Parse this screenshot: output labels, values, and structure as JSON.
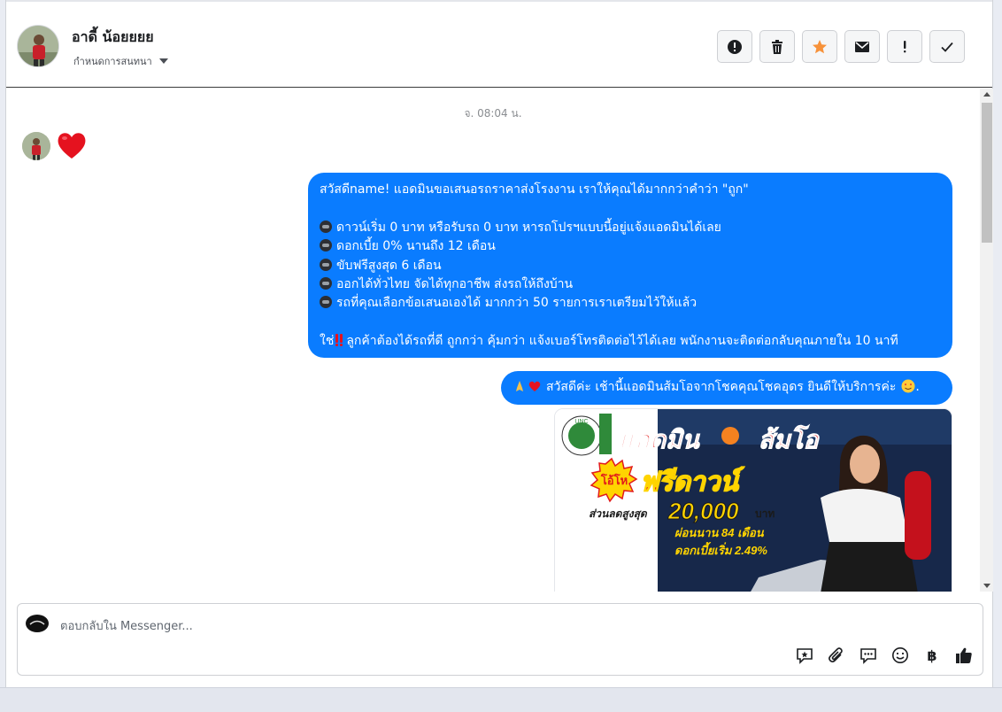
{
  "header": {
    "contact_name": "อาดี้ น้อยยยย",
    "label_action": "กำหนดการสนทนา",
    "actions": [
      {
        "name": "spam-button",
        "icon": "exclamation-circle-icon"
      },
      {
        "name": "delete-button",
        "icon": "trash-icon"
      },
      {
        "name": "star-button",
        "icon": "star-icon"
      },
      {
        "name": "mark-unread-button",
        "icon": "envelope-icon"
      },
      {
        "name": "follow-up-button",
        "icon": "exclamation-icon"
      },
      {
        "name": "mark-done-button",
        "icon": "check-icon"
      }
    ]
  },
  "thread": {
    "timestamp": "จ. 08:04 น.",
    "incoming_reaction": "heart-icon",
    "message1": {
      "line1": "สวัสดีname! แอดมินขอเสนอรถราคาส่งโรงงาน เราให้คุณได้มากกว่าคำว่า \"ถูก\"",
      "bullets": [
        "ดาวน์เริ่ม 0 บาท หรือรับรถ 0 บาท หารถโปรฯแบบนี้อยู่แจ้งแอดมินได้เลย",
        "ดอกเบี้ย 0% นานถึง 12 เดือน",
        "ขับฟรีสูงสุด 6 เดือน",
        "ออกได้ทั่วไทย จัดได้ทุกอาชีพ ส่งรถให้ถึงบ้าน",
        "รถที่คุณเลือกข้อเสนอเองได้ มากกว่า 50 รายการเราเตรียมไว้ให้แล้ว"
      ],
      "closing_prefix": "ใช่",
      "closing": "ลูกค้าต้องได้รถที่ดี ถูกกว่า คุ้มกว่า แจ้งเบอร์โทรติดต่อไว้ได้เลย พนักงานจะติดต่อกลับคุณภายใน 10 นาที"
    },
    "message2": {
      "text": "สวัสดีค่ะ เช้านี้แอดมินส้มโอจากโชคคุณโชคอุดร ยินดีให้บริการค่ะ",
      "trailing": "."
    },
    "promo_image": {
      "headline": "แอดมิน",
      "headline2": "ส้มโอ",
      "burst_label": "โอ้โห",
      "free_down": "ฟรีดาวน์",
      "discount_label": "ส่วนลดสูงสุด",
      "discount_amount": "20,000",
      "discount_unit": "บาท",
      "installment": "ผ่อนนาน 84 เดือน",
      "interest": "ดอกเบี้ยเริ่ม 2.49%",
      "logo_text": "UNC"
    }
  },
  "composer": {
    "placeholder": "ตอบกลับใน Messenger...",
    "tools": [
      "saved-reply-icon",
      "attachment-icon",
      "chat-icon",
      "emoji-icon",
      "baht-icon",
      "thumbs-up-icon"
    ],
    "baht_symbol": "฿"
  },
  "colors": {
    "bubble": "#0a7cff",
    "star": "#f7923a",
    "promo_red": "#e21b1b",
    "promo_yellow": "#ffd400"
  }
}
